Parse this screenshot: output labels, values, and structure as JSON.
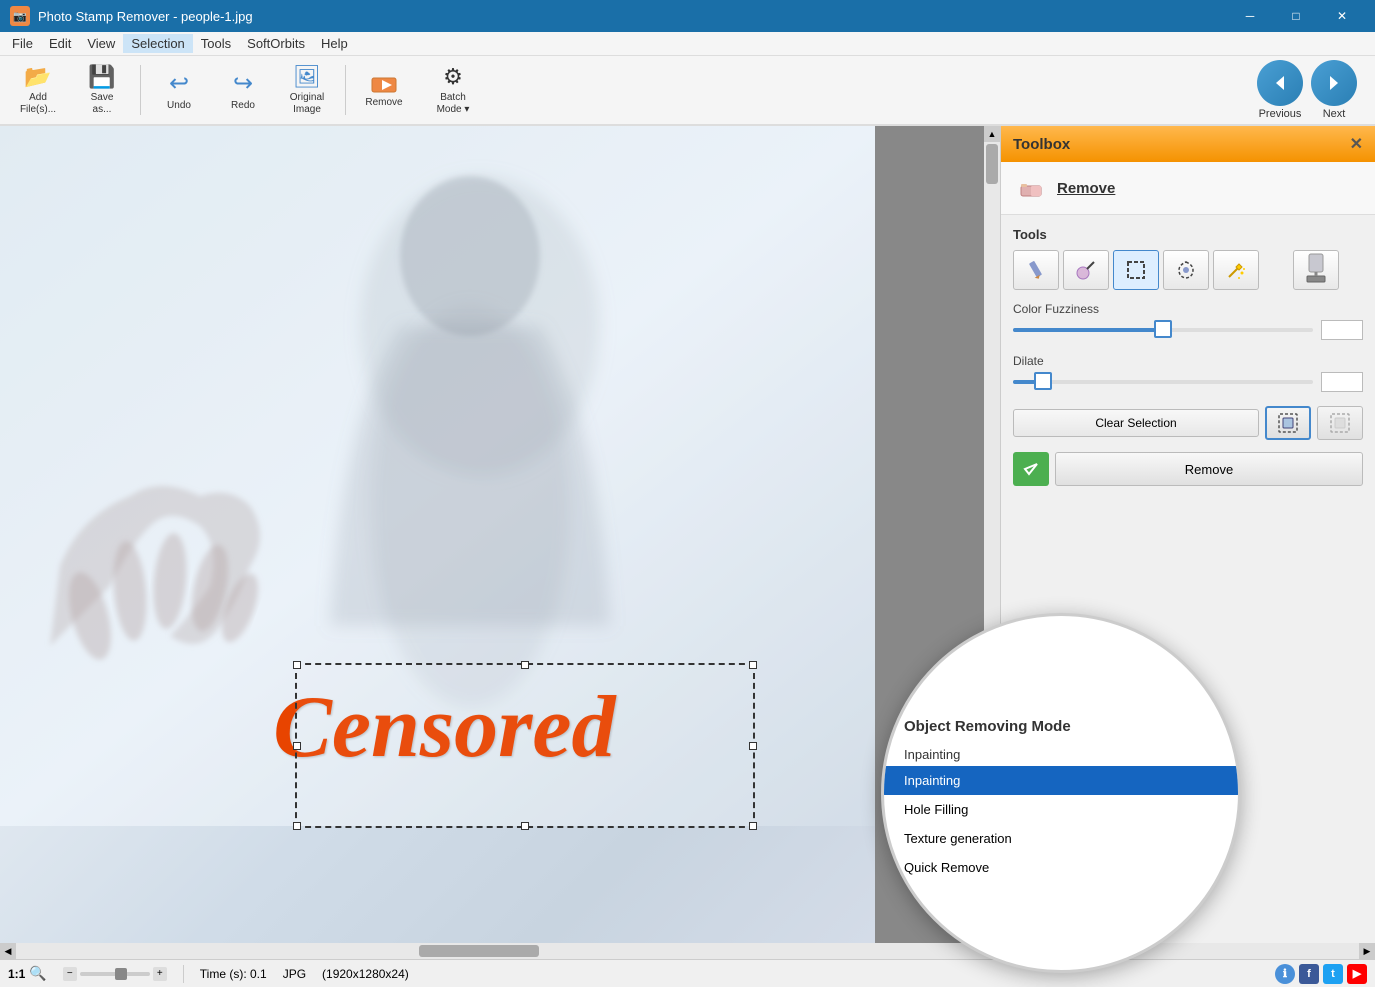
{
  "titlebar": {
    "app_icon": "PSR",
    "title": "Photo Stamp Remover - people-1.jpg",
    "minimize": "─",
    "maximize": "□",
    "close": "✕"
  },
  "menubar": {
    "items": [
      "File",
      "Edit",
      "View",
      "Selection",
      "Tools",
      "SoftOrbits",
      "Help"
    ]
  },
  "toolbar": {
    "buttons": [
      {
        "id": "add-files",
        "icon": "📂",
        "label": "Add\nFile(s)..."
      },
      {
        "id": "save-as",
        "icon": "💾",
        "label": "Save\nas..."
      },
      {
        "id": "undo",
        "icon": "↩",
        "label": "Undo"
      },
      {
        "id": "redo",
        "icon": "↪",
        "label": "Redo"
      },
      {
        "id": "original-image",
        "icon": "🖼",
        "label": "Original\nImage"
      },
      {
        "id": "remove",
        "icon": "✂",
        "label": "Remove"
      },
      {
        "id": "batch-mode",
        "icon": "⚙",
        "label": "Batch\nMode"
      }
    ],
    "previous_label": "Previous",
    "next_label": "Next"
  },
  "canvas": {
    "watermark_text": "Censored"
  },
  "toolbox": {
    "title": "Toolbox",
    "section_title": "Remove",
    "close_btn": "✕",
    "tools_label": "Tools",
    "tools": [
      {
        "id": "pencil",
        "icon": "✏",
        "title": "Pencil tool"
      },
      {
        "id": "magic-wand",
        "icon": "🪄",
        "title": "Magic wand"
      },
      {
        "id": "rect-select",
        "icon": "⬚",
        "title": "Rectangle select"
      },
      {
        "id": "smart-select",
        "icon": "⚙",
        "title": "Smart select"
      },
      {
        "id": "magic-fill",
        "icon": "✨",
        "title": "Magic fill"
      },
      {
        "id": "stamp",
        "icon": "🔖",
        "title": "Stamp tool"
      }
    ],
    "color_fuzziness": {
      "label": "Color Fuzziness",
      "value": 50,
      "min": 0,
      "max": 100,
      "percent": 50
    },
    "dilate": {
      "label": "Dilate",
      "value": 2,
      "min": 0,
      "max": 20,
      "percent": 10
    },
    "clear_selection_btn": "Clear Selection",
    "object_removing_mode": {
      "label": "Object Removing Mode",
      "current": "Inpainting",
      "options": [
        {
          "id": "inpainting-label",
          "label": "Inpainting",
          "is_header": true
        },
        {
          "id": "inpainting",
          "label": "Inpainting",
          "selected": true
        },
        {
          "id": "hole-filling",
          "label": "Hole Filling",
          "selected": false
        },
        {
          "id": "texture-gen",
          "label": "Texture generation",
          "selected": false
        },
        {
          "id": "quick-remove",
          "label": "Quick Remove",
          "selected": false
        }
      ]
    },
    "remove_btn": "Remove"
  },
  "statusbar": {
    "zoom_label": "1:1",
    "zoom_icon": "🔍",
    "time_label": "Time (s): 0.1",
    "format_label": "JPG",
    "dimensions_label": "(1920x1280x24)"
  }
}
